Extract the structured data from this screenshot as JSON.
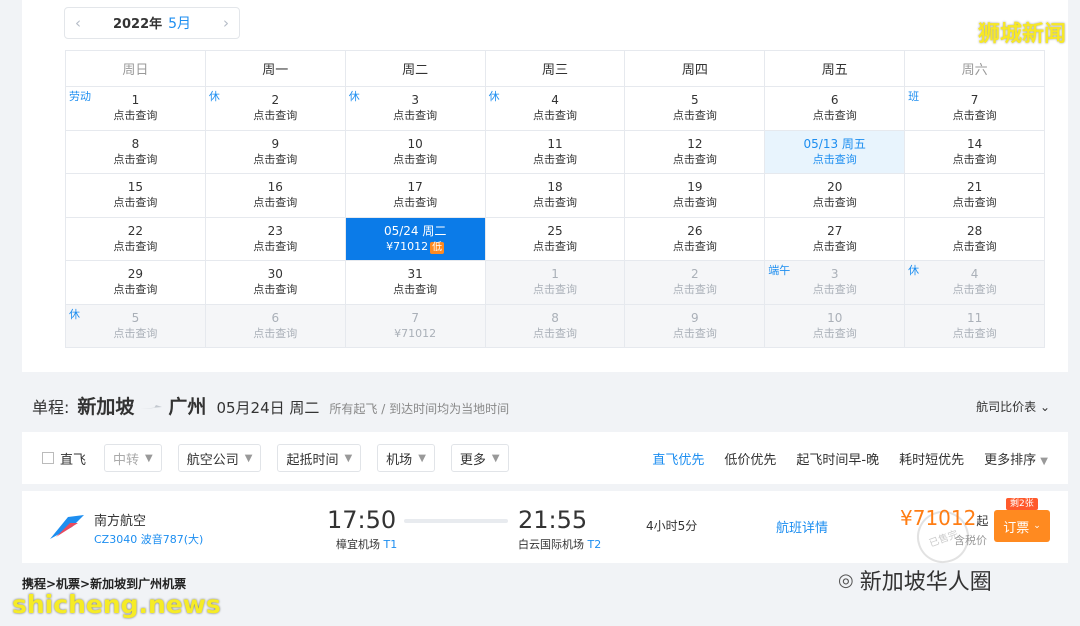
{
  "calendar": {
    "year_label": "2022年",
    "month_label": "5月",
    "prev_arrow": "‹",
    "next_arrow": "›",
    "weekdays": [
      "周日",
      "周一",
      "周二",
      "周三",
      "周四",
      "周五",
      "周六"
    ],
    "weeks": [
      [
        {
          "day": "1",
          "sub": "点击查询",
          "tag": "劳动"
        },
        {
          "day": "2",
          "sub": "点击查询",
          "tag": "休"
        },
        {
          "day": "3",
          "sub": "点击查询",
          "tag": "休"
        },
        {
          "day": "4",
          "sub": "点击查询",
          "tag": "休"
        },
        {
          "day": "5",
          "sub": "点击查询"
        },
        {
          "day": "6",
          "sub": "点击查询"
        },
        {
          "day": "7",
          "sub": "点击查询",
          "tag": "班"
        }
      ],
      [
        {
          "day": "8",
          "sub": "点击查询"
        },
        {
          "day": "9",
          "sub": "点击查询"
        },
        {
          "day": "10",
          "sub": "点击查询"
        },
        {
          "day": "11",
          "sub": "点击查询"
        },
        {
          "day": "12",
          "sub": "点击查询"
        },
        {
          "day": "05/13 周五",
          "sub": "点击查询",
          "state": "today"
        },
        {
          "day": "14",
          "sub": "点击查询"
        }
      ],
      [
        {
          "day": "15",
          "sub": "点击查询"
        },
        {
          "day": "16",
          "sub": "点击查询"
        },
        {
          "day": "17",
          "sub": "点击查询"
        },
        {
          "day": "18",
          "sub": "点击查询"
        },
        {
          "day": "19",
          "sub": "点击查询"
        },
        {
          "day": "20",
          "sub": "点击查询"
        },
        {
          "day": "21",
          "sub": "点击查询"
        }
      ],
      [
        {
          "day": "22",
          "sub": "点击查询"
        },
        {
          "day": "23",
          "sub": "点击查询"
        },
        {
          "day": "05/24 周二",
          "sub": "¥71012",
          "low": "低",
          "state": "sel"
        },
        {
          "day": "25",
          "sub": "点击查询"
        },
        {
          "day": "26",
          "sub": "点击查询"
        },
        {
          "day": "27",
          "sub": "点击查询"
        },
        {
          "day": "28",
          "sub": "点击查询"
        }
      ],
      [
        {
          "day": "29",
          "sub": "点击查询"
        },
        {
          "day": "30",
          "sub": "点击查询"
        },
        {
          "day": "31",
          "sub": "点击查询"
        },
        {
          "day": "1",
          "sub": "点击查询",
          "state": "other"
        },
        {
          "day": "2",
          "sub": "点击查询",
          "state": "other"
        },
        {
          "day": "3",
          "sub": "点击查询",
          "state": "other",
          "tag": "端午"
        },
        {
          "day": "4",
          "sub": "点击查询",
          "state": "other",
          "tag": "休"
        }
      ],
      [
        {
          "day": "5",
          "sub": "点击查询",
          "state": "other",
          "tag": "休"
        },
        {
          "day": "6",
          "sub": "点击查询",
          "state": "other"
        },
        {
          "day": "7",
          "sub": "¥71012",
          "state": "other"
        },
        {
          "day": "8",
          "sub": "点击查询",
          "state": "other"
        },
        {
          "day": "9",
          "sub": "点击查询",
          "state": "other"
        },
        {
          "day": "10",
          "sub": "点击查询",
          "state": "other"
        },
        {
          "day": "11",
          "sub": "点击查询",
          "state": "other"
        }
      ]
    ]
  },
  "watermark_top": "狮城新闻",
  "trip": {
    "label": "单程:",
    "from": "新加坡",
    "to": "广州",
    "date": "05月24日 周二",
    "note": "所有起飞 / 到达时间均为当地时间",
    "compare": "航司比价表"
  },
  "filters": {
    "direct": "直飞",
    "transfer": "中转",
    "airline": "航空公司",
    "time": "起抵时间",
    "airport": "机场",
    "more": "更多"
  },
  "sorts": [
    "直飞优先",
    "低价优先",
    "起飞时间早-晚",
    "耗时短优先",
    "更多排序"
  ],
  "flight": {
    "airline": "南方航空",
    "number": "CZ3040",
    "aircraft": "波音787(大)",
    "dep_time": "17:50",
    "dep_airport": "樟宜机场",
    "dep_terminal": "T1",
    "arr_time": "21:55",
    "arr_airport": "白云国际机场",
    "arr_terminal": "T2",
    "duration": "4小时5分",
    "details": "航班详情",
    "price": "¥71012",
    "price_suffix": "起",
    "tax_note": "含税价",
    "stamp": "已售完",
    "book": "订票",
    "tickets_left": "剩2张"
  },
  "breadcrumb": "携程>机票>新加坡到广州机票",
  "wechat_label": "新加坡华人圈",
  "site_watermark": "shicheng.news",
  "colors": {
    "accent": "#1d8ef0",
    "selected": "#0b7be8",
    "price": "#ff7d13"
  }
}
